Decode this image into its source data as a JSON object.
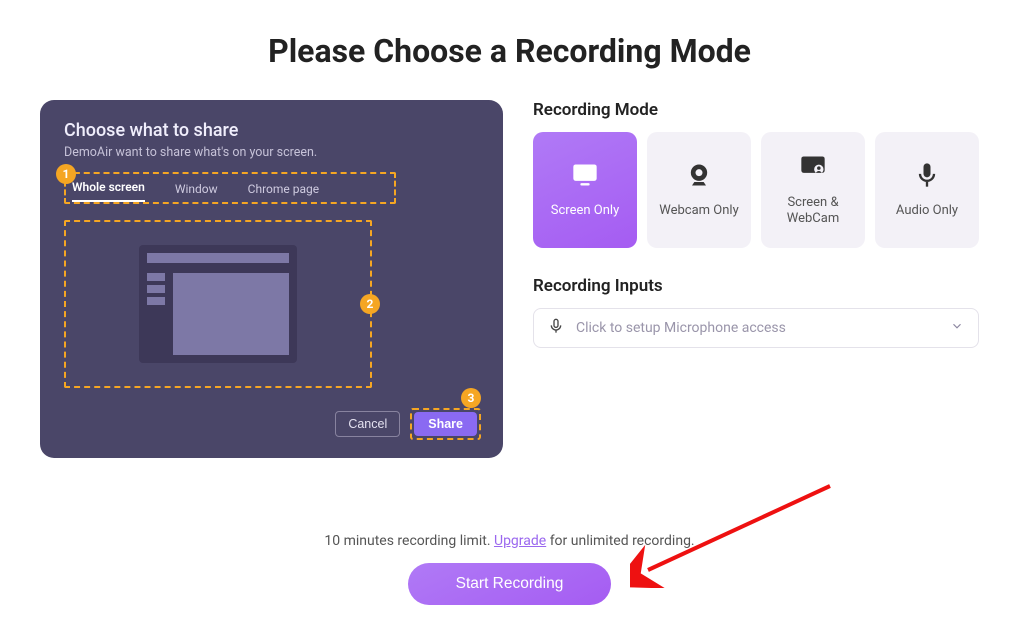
{
  "title": "Please Choose a Recording Mode",
  "share_panel": {
    "title": "Choose what to share",
    "subtitle": "DemoAir want to share what's on your screen.",
    "tabs": {
      "badge": "1",
      "items": [
        "Whole screen",
        "Window",
        "Chrome page"
      ],
      "active_index": 0
    },
    "preview_badge": "2",
    "actions": {
      "cancel": "Cancel",
      "share": "Share",
      "share_badge": "3"
    }
  },
  "recording_mode": {
    "label": "Recording Mode",
    "options": [
      {
        "id": "screen-only",
        "label": "Screen Only",
        "icon": "monitor-icon"
      },
      {
        "id": "webcam-only",
        "label": "Webcam Only",
        "icon": "webcam-icon"
      },
      {
        "id": "screen-webcam",
        "label": "Screen & WebCam",
        "icon": "screen-cam-icon"
      },
      {
        "id": "audio-only",
        "label": "Audio Only",
        "icon": "mic-icon"
      }
    ],
    "active_index": 0
  },
  "recording_inputs": {
    "label": "Recording Inputs",
    "mic_placeholder": "Click to setup Microphone access"
  },
  "footer": {
    "limit_pre": "10 minutes recording limit. ",
    "upgrade": "Upgrade",
    "limit_post": " for unlimited recording.",
    "start": "Start Recording"
  }
}
